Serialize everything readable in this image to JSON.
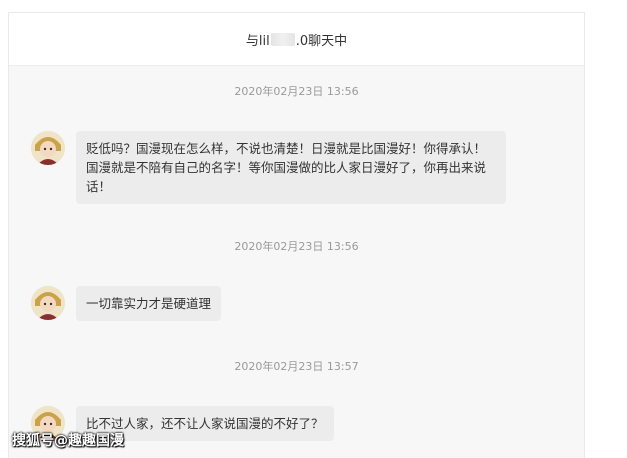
{
  "header": {
    "title_prefix": "与lil",
    "title_suffix": ".0聊天中"
  },
  "messages": [
    {
      "time": "2020年02月23日 13:56",
      "text": "贬低吗？国漫现在怎么样，不说也清楚！日漫就是比国漫好！你得承认！国漫就是不陪有自己的名字！等你国漫做的比人家日漫好了，你再出来说话！"
    },
    {
      "time": "2020年02月23日 13:56",
      "text": "一切靠实力才是硬道理"
    },
    {
      "time": "2020年02月23日 13:57",
      "text": "比不过人家，还不让人家说国漫的不好了？"
    }
  ],
  "watermark": "搜狐号@趣趣国漫",
  "colors": {
    "panel_bg": "#f7f7f7",
    "bubble_bg": "#ececec",
    "timestamp": "#9a9a9a"
  }
}
